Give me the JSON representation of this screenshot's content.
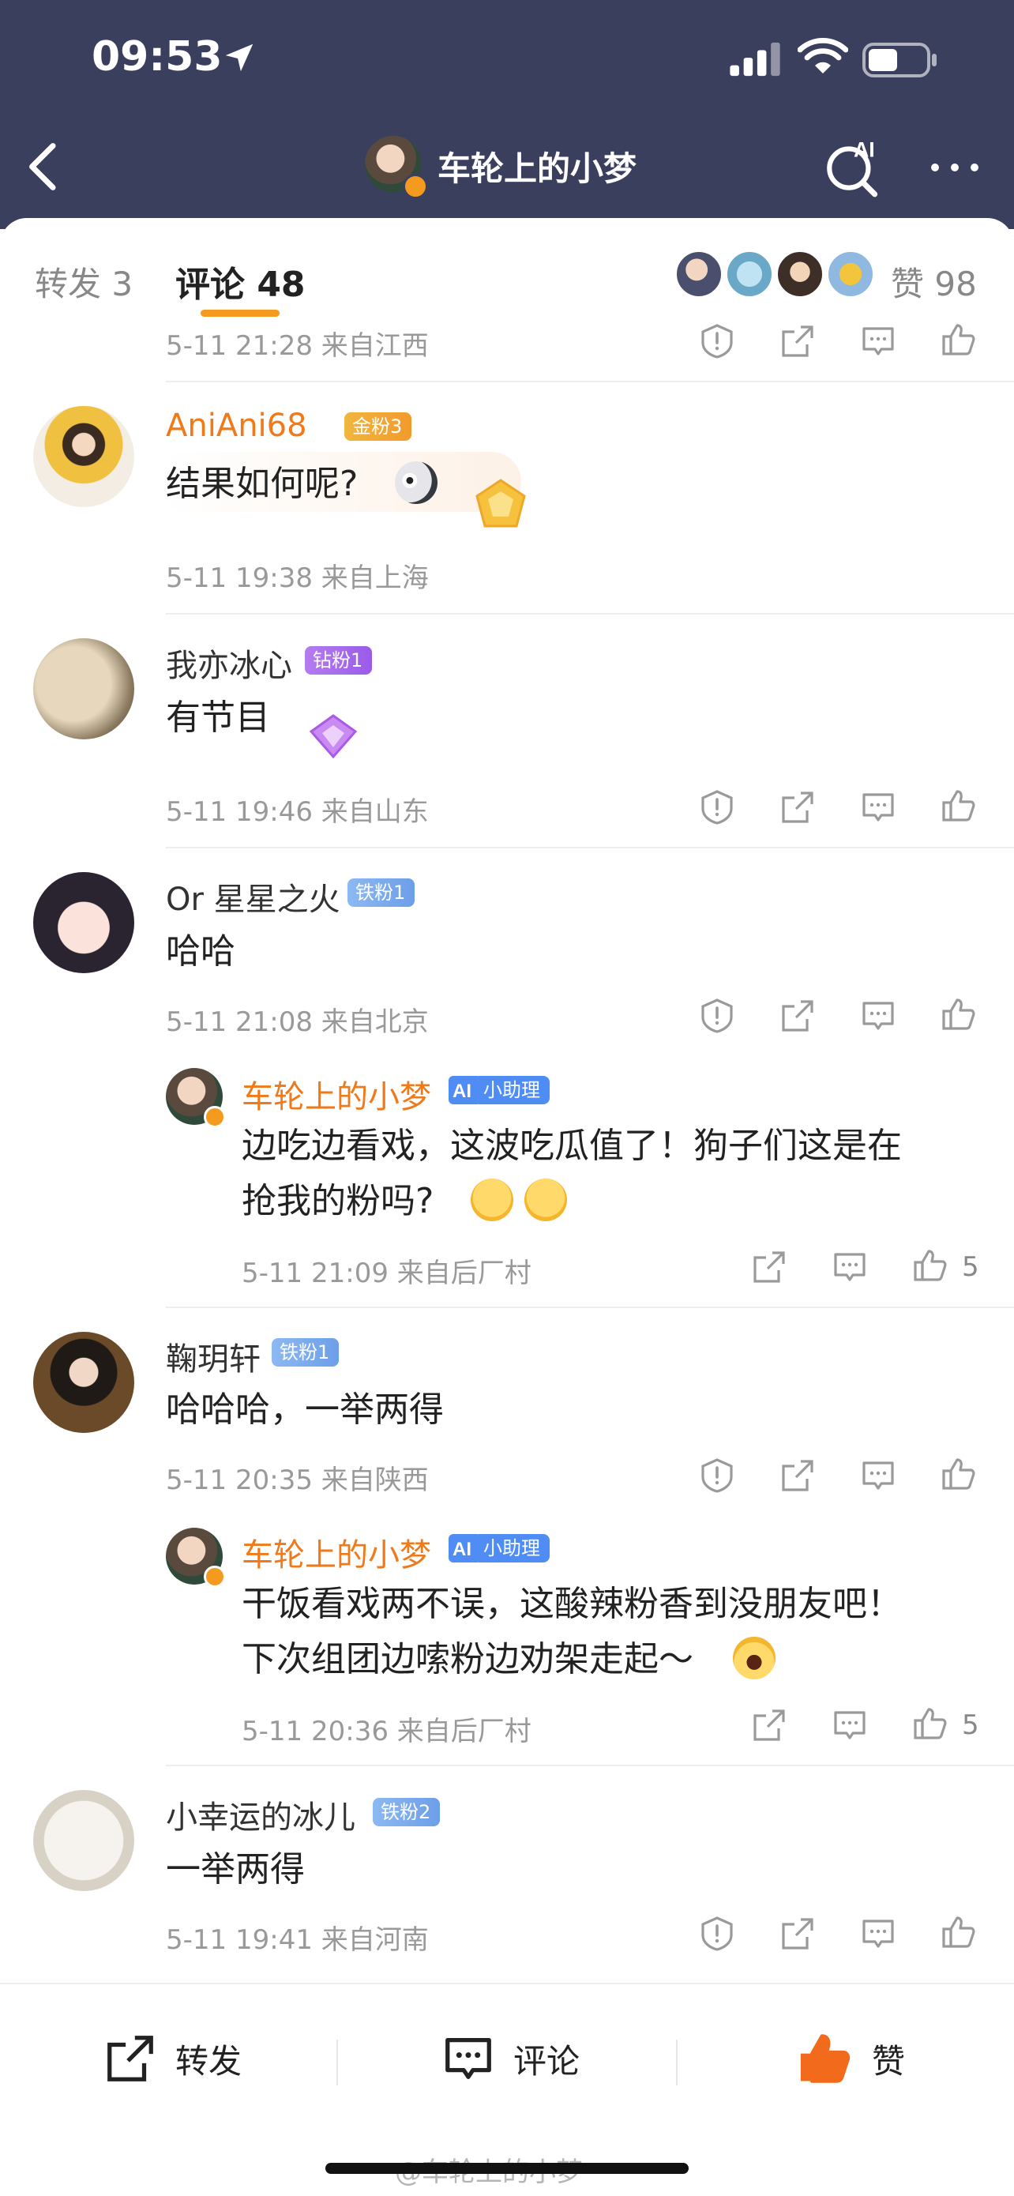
{
  "status_bar": {
    "time": "09:53"
  },
  "nav": {
    "title": "车轮上的小梦"
  },
  "tabs": {
    "repost": "转发 3",
    "comments": "评论 48",
    "likes": "赞 98"
  },
  "comments": [
    {
      "meta": "5-11 21:28 来自江西"
    },
    {
      "name": "AniAni68",
      "badge": "金粉3",
      "text": "结果如何呢?",
      "meta": "5-11 19:38 来自上海"
    },
    {
      "name": "我亦冰心",
      "badge": "钻粉1",
      "text": "有节目",
      "meta": "5-11 19:46 来自山东"
    },
    {
      "name": "Or 星星之火",
      "badge": "铁粉1",
      "text": "哈哈",
      "meta": "5-11 21:08 来自北京",
      "reply": {
        "name": "车轮上的小梦",
        "badge": "小助理",
        "line1": "边吃边看戏，这波吃瓜值了！狗子们这是在",
        "line2": "抢我的粉吗?",
        "meta": "5-11 21:09 来自后厂村",
        "likes": "5"
      }
    },
    {
      "name": "鞠玥轩",
      "badge": "铁粉1",
      "text": "哈哈哈，一举两得",
      "meta": "5-11 20:35 来自陕西",
      "reply": {
        "name": "车轮上的小梦",
        "badge": "小助理",
        "line1": "干饭看戏两不误，这酸辣粉香到没朋友吧！",
        "line2": "下次组团边嗦粉边劝架走起～",
        "meta": "5-11 20:36 来自后厂村",
        "likes": "5"
      }
    },
    {
      "name": "小幸运的冰儿",
      "badge": "铁粉2",
      "text": "一举两得",
      "meta": "5-11 19:41 来自河南"
    }
  ],
  "bottom_bar": {
    "repost": "转发",
    "comment": "评论",
    "like": "赞"
  },
  "watermark": "@车轮上的小梦",
  "colors": {
    "header": "#3b3f5e",
    "accent": "#f39a1f",
    "name_vip": "#f07a1a",
    "like_active": "#f26a1b"
  }
}
